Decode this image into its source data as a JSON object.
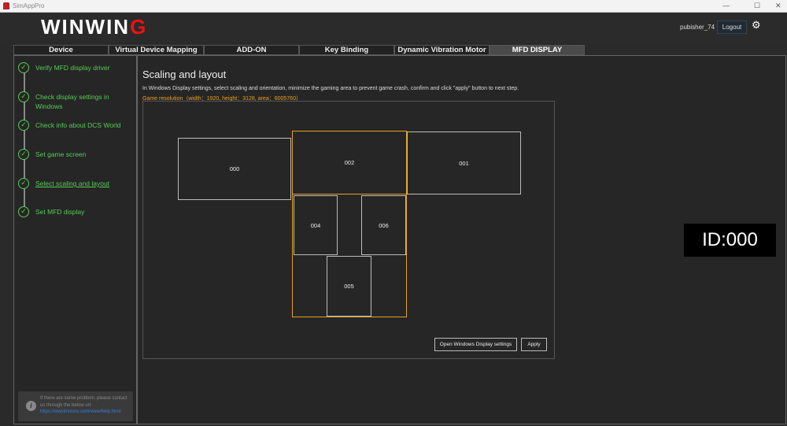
{
  "window": {
    "title": "SimAppPro",
    "min": "—",
    "max": "☐",
    "close": "✕"
  },
  "header": {
    "logo_main": "WINWIN",
    "logo_accent": "G",
    "username": "pubisher_74",
    "logout": "Logout"
  },
  "tabs": [
    {
      "label": "Device"
    },
    {
      "label": "Virtual Device Mapping"
    },
    {
      "label": "ADD-ON"
    },
    {
      "label": "Key Binding"
    },
    {
      "label": "Dynamic Vibration Motor"
    },
    {
      "label": "MFD DISPLAY"
    }
  ],
  "steps": [
    {
      "label": "Verify MFD display driver"
    },
    {
      "label": "Check display settings in Windows"
    },
    {
      "label": "Check info about DCS World"
    },
    {
      "label": "Set game screen"
    },
    {
      "label": "Select scaling and layout"
    },
    {
      "label": "Set MFD display"
    }
  ],
  "help": {
    "text": "If there are some problem, please contact us through the below url:",
    "url": "https://wwsimstore.com/view/help.html"
  },
  "main": {
    "title": "Scaling and layout",
    "description": "In Windows Display settings, select scaling and orientation, minimize the gaming area to prevent game crash, confirm and click \"apply\" button to next step.",
    "resolution": "Game resolution（width：1920,   height：3128,   area：6005760）",
    "monitors": [
      "000",
      "002",
      "001",
      "004",
      "006",
      "005"
    ],
    "open_settings": "Open Windows Display settings",
    "apply": "Apply"
  },
  "id_display": "ID:000"
}
